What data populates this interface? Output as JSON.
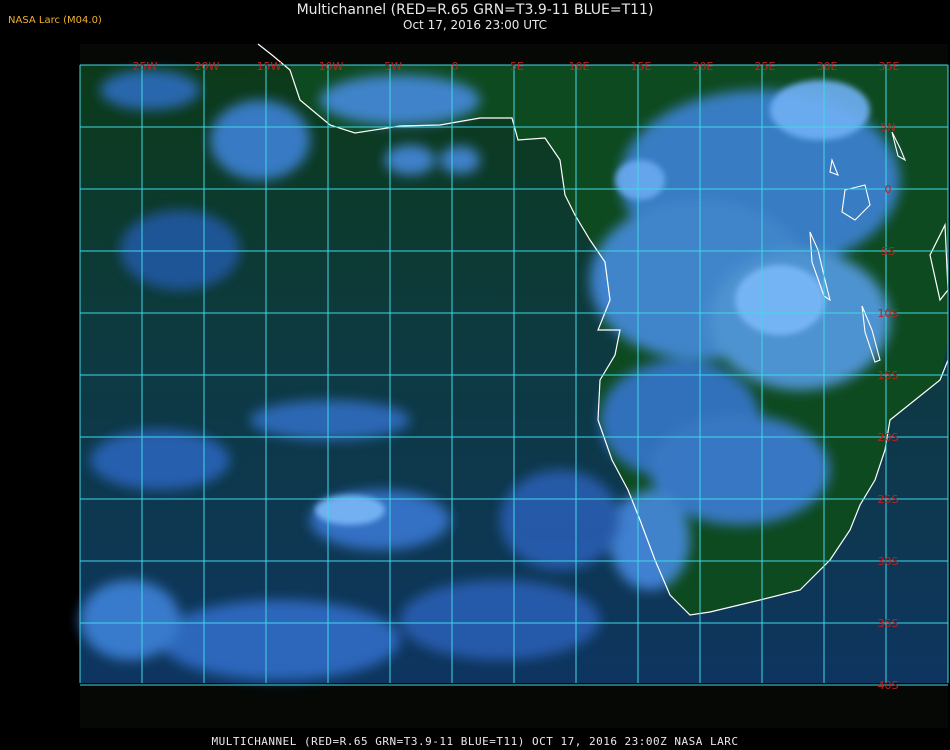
{
  "header": {
    "title": "Multichannel (RED=R.65 GRN=T3.9-11 BLUE=T11)",
    "subtitle": "Oct 17, 2016 23:00 UTC",
    "credit": "NASA Larc (M04.0)"
  },
  "footer": {
    "text": "MULTICHANNEL (RED=R.65 GRN=T3.9-11 BLUE=T11) OCT 17, 2016 23:00Z  NASA LARC"
  },
  "map": {
    "lon_labels": [
      "25W",
      "20W",
      "15W",
      "10W",
      "5W",
      "0",
      "5E",
      "10E",
      "15E",
      "20E",
      "25E",
      "30E",
      "35E"
    ],
    "lat_labels": [
      "5N",
      "0",
      "5S",
      "10S",
      "15S",
      "20S",
      "25S",
      "30S",
      "35S",
      "40S"
    ],
    "colors": {
      "grid": "#3fd8e8",
      "coast": "#ffffff",
      "ocean": "#0e3a5a",
      "land": "#0f4a1a",
      "cloud": "#4a8ee8",
      "label": "#c02020"
    }
  }
}
